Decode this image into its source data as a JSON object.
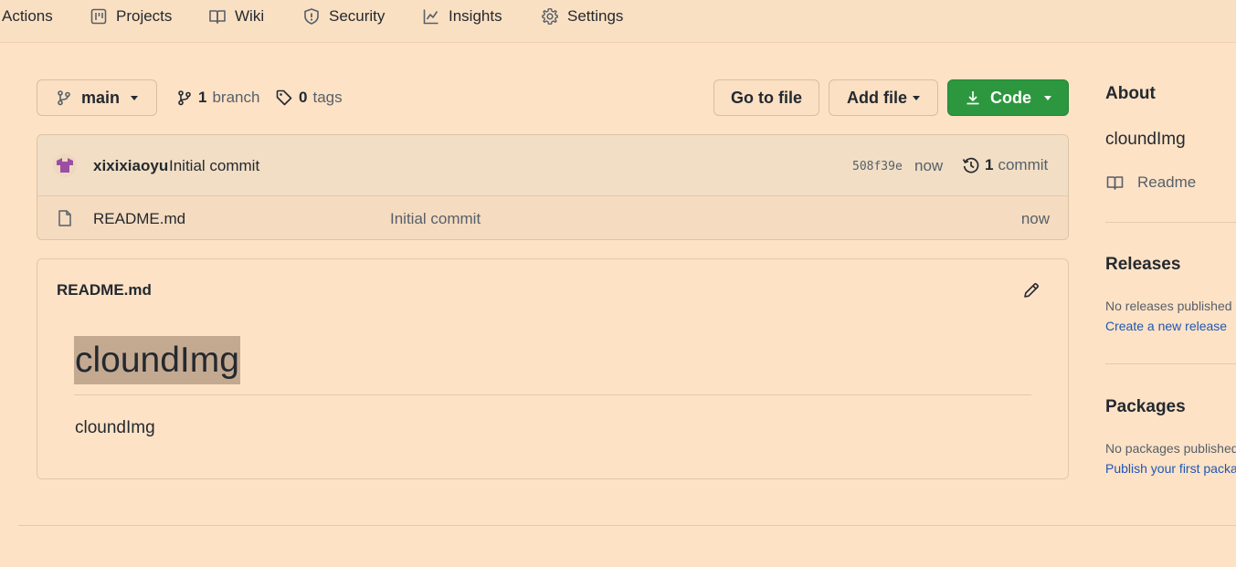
{
  "nav": {
    "items": [
      {
        "label": "Actions",
        "icon": "play-icon"
      },
      {
        "label": "Projects",
        "icon": "project-board-icon"
      },
      {
        "label": "Wiki",
        "icon": "book-icon"
      },
      {
        "label": "Security",
        "icon": "shield-icon"
      },
      {
        "label": "Insights",
        "icon": "graph-icon"
      },
      {
        "label": "Settings",
        "icon": "gear-icon"
      }
    ]
  },
  "toolbar": {
    "branch_select": "main",
    "branches_count": "1",
    "branches_label": "branch",
    "tags_count": "0",
    "tags_label": "tags",
    "go_to_file": "Go to file",
    "add_file": "Add file",
    "code": "Code"
  },
  "commit": {
    "author": "xixixiaoyu",
    "message": "Initial commit",
    "sha": "508f39e",
    "time": "now",
    "count": "1",
    "count_label": "commit"
  },
  "files": [
    {
      "name": "README.md",
      "message": "Initial commit",
      "time": "now",
      "icon": "file-icon"
    }
  ],
  "readme": {
    "filename": "README.md",
    "heading": "cloundImg",
    "body": "cloundImg"
  },
  "sidebar": {
    "about_title": "About",
    "about_desc": "cloundImg",
    "readme_link": "Readme",
    "releases_title": "Releases",
    "releases_empty": "No releases published",
    "releases_link": "Create a new release",
    "packages_title": "Packages",
    "packages_empty": "No packages published",
    "packages_link": "Publish your first package"
  },
  "colors": {
    "background": "#fde2c6",
    "code_button": "#2c973e",
    "link": "#1f57b5",
    "highlight": "#c4a991"
  }
}
